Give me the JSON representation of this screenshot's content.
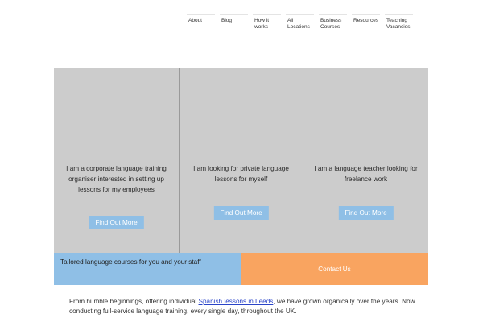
{
  "nav": {
    "items": [
      {
        "line1": "About",
        "line2": ""
      },
      {
        "line1": "Blog",
        "line2": ""
      },
      {
        "line1": "How it",
        "line2": "works"
      },
      {
        "line1": "All",
        "line2": "Locations"
      },
      {
        "line1": "Business",
        "line2": "Courses"
      },
      {
        "line1": "Resources",
        "line2": ""
      },
      {
        "line1": "Teaching",
        "line2": "Vacancies"
      }
    ]
  },
  "panels": [
    {
      "text": "I am a corporate language training organiser interested in setting up lessons for my employees",
      "button": "Find Out More"
    },
    {
      "text": "I am looking for private language lessons for myself",
      "button": "Find Out More"
    },
    {
      "text": "I am a language teacher looking for freelance work",
      "button": "Find Out More"
    }
  ],
  "strip": {
    "left_text": "Tailored language courses for you and your staff",
    "contact_label": "Contact Us"
  },
  "intro": {
    "before": "From humble beginnings, offering individual ",
    "link": "Spanish lessons in Leeds",
    "after": ", we have grown organically over the years. Now conducting full-service language training, every single day, throughout the UK."
  },
  "colors": {
    "panel_bg": "#cccccc",
    "button_bg": "#8fbfe6",
    "contact_bg": "#f9a460",
    "link": "#2a44c8"
  }
}
